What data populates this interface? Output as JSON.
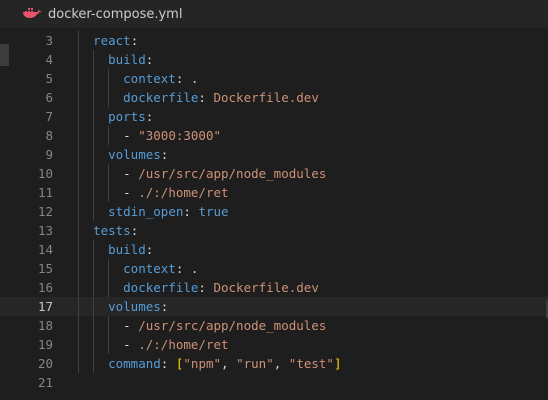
{
  "tab": {
    "filename": "docker-compose.yml",
    "icon": "docker-icon"
  },
  "lines": [
    {
      "num": "3",
      "indent": "  ",
      "tokens": [
        {
          "t": "react",
          "c": "k"
        },
        {
          "t": ":",
          "c": "p"
        }
      ]
    },
    {
      "num": "4",
      "indent": "    ",
      "tokens": [
        {
          "t": "build",
          "c": "k"
        },
        {
          "t": ":",
          "c": "p"
        }
      ]
    },
    {
      "num": "5",
      "indent": "      ",
      "tokens": [
        {
          "t": "context",
          "c": "k"
        },
        {
          "t": ": ",
          "c": "p"
        },
        {
          "t": ".",
          "c": "p"
        }
      ]
    },
    {
      "num": "6",
      "indent": "      ",
      "tokens": [
        {
          "t": "dockerfile",
          "c": "k"
        },
        {
          "t": ": ",
          "c": "p"
        },
        {
          "t": "Dockerfile.dev",
          "c": "s"
        }
      ]
    },
    {
      "num": "7",
      "indent": "    ",
      "tokens": [
        {
          "t": "ports",
          "c": "k"
        },
        {
          "t": ":",
          "c": "p"
        }
      ]
    },
    {
      "num": "8",
      "indent": "      ",
      "tokens": [
        {
          "t": "- ",
          "c": "p"
        },
        {
          "t": "\"3000:3000\"",
          "c": "s"
        }
      ]
    },
    {
      "num": "9",
      "indent": "    ",
      "tokens": [
        {
          "t": "volumes",
          "c": "k"
        },
        {
          "t": ":",
          "c": "p"
        }
      ]
    },
    {
      "num": "10",
      "indent": "      ",
      "tokens": [
        {
          "t": "- ",
          "c": "p"
        },
        {
          "t": "/usr/src/app/node_modules",
          "c": "s"
        }
      ]
    },
    {
      "num": "11",
      "indent": "      ",
      "tokens": [
        {
          "t": "- ",
          "c": "p"
        },
        {
          "t": "./:/home/ret",
          "c": "s"
        }
      ]
    },
    {
      "num": "12",
      "indent": "    ",
      "tokens": [
        {
          "t": "stdin_open",
          "c": "k"
        },
        {
          "t": ": ",
          "c": "p"
        },
        {
          "t": "true",
          "c": "c"
        }
      ]
    },
    {
      "num": "13",
      "indent": "  ",
      "tokens": [
        {
          "t": "tests",
          "c": "k"
        },
        {
          "t": ":",
          "c": "p"
        }
      ]
    },
    {
      "num": "14",
      "indent": "    ",
      "tokens": [
        {
          "t": "build",
          "c": "k"
        },
        {
          "t": ":",
          "c": "p"
        }
      ]
    },
    {
      "num": "15",
      "indent": "      ",
      "tokens": [
        {
          "t": "context",
          "c": "k"
        },
        {
          "t": ": ",
          "c": "p"
        },
        {
          "t": ".",
          "c": "p"
        }
      ]
    },
    {
      "num": "16",
      "indent": "      ",
      "tokens": [
        {
          "t": "dockerfile",
          "c": "k"
        },
        {
          "t": ": ",
          "c": "p"
        },
        {
          "t": "Dockerfile.dev",
          "c": "s"
        }
      ]
    },
    {
      "num": "17",
      "indent": "    ",
      "tokens": [
        {
          "t": "volumes",
          "c": "k"
        },
        {
          "t": ":",
          "c": "p"
        }
      ],
      "current": true
    },
    {
      "num": "18",
      "indent": "      ",
      "tokens": [
        {
          "t": "- ",
          "c": "p"
        },
        {
          "t": "/usr/src/app/node_modules",
          "c": "s"
        }
      ]
    },
    {
      "num": "19",
      "indent": "      ",
      "tokens": [
        {
          "t": "- ",
          "c": "p"
        },
        {
          "t": "./:/home/ret",
          "c": "s"
        }
      ]
    },
    {
      "num": "20",
      "indent": "    ",
      "tokens": [
        {
          "t": "command",
          "c": "k"
        },
        {
          "t": ": ",
          "c": "p"
        },
        {
          "t": "[",
          "c": "b"
        },
        {
          "t": "\"npm\"",
          "c": "s"
        },
        {
          "t": ", ",
          "c": "p"
        },
        {
          "t": "\"run\"",
          "c": "s"
        },
        {
          "t": ", ",
          "c": "p"
        },
        {
          "t": "\"test\"",
          "c": "s"
        },
        {
          "t": "]",
          "c": "b"
        }
      ]
    },
    {
      "num": "21",
      "indent": "",
      "tokens": []
    }
  ],
  "colors": {
    "keyword": "#569cd6",
    "string": "#ce9178",
    "bracket": "#ffd700",
    "background": "#1e1e1e"
  }
}
